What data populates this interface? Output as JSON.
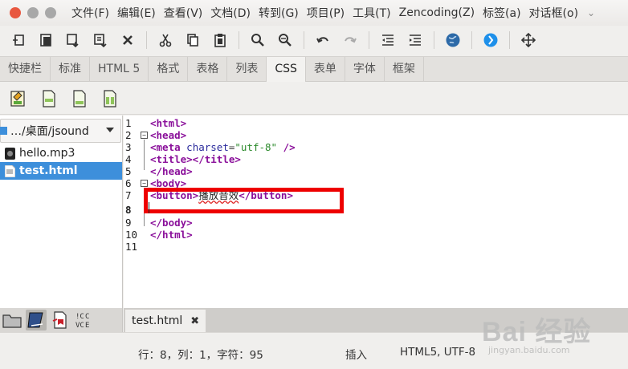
{
  "menubar": {
    "window_buttons": [
      {
        "name": "close",
        "color": "#e8573f"
      },
      {
        "name": "minimize",
        "color": "#a8a8a8"
      },
      {
        "name": "maximize",
        "color": "#a8a8a8"
      }
    ],
    "items": [
      "文件(F)",
      "编辑(E)",
      "查看(V)",
      "文档(D)",
      "转到(G)",
      "项目(P)",
      "工具(T)",
      "Zencoding(Z)",
      "标签(a)",
      "对话框(o)"
    ],
    "more_icon": "chevron-down-icon"
  },
  "toolbar": {
    "buttons": [
      "new-file-icon",
      "open-file-icon",
      "save-icon",
      "save-as-icon",
      "close-icon",
      "cut-icon",
      "copy-icon",
      "paste-icon",
      "search-icon",
      "search-replace-icon",
      "undo-icon",
      "redo-icon",
      "indent-less-icon",
      "indent-more-icon",
      "preview-globe-icon",
      "bluefish-icon",
      "fullscreen-icon"
    ]
  },
  "tabs": {
    "items": [
      "快捷栏",
      "标准",
      "HTML 5",
      "格式",
      "表格",
      "列表",
      "CSS",
      "表单",
      "字体",
      "框架"
    ],
    "active_index": 6
  },
  "subbar": {
    "icons": [
      "css-dialog-icon",
      "style-doc-icon",
      "blank-doc-icon",
      "two-col-doc-icon"
    ]
  },
  "filebrowser": {
    "path": "…/桌面/jsound",
    "files": [
      {
        "name": "hello.mp3",
        "type": "audio",
        "selected": false
      },
      {
        "name": "test.html",
        "type": "html",
        "selected": true
      }
    ]
  },
  "leftbottom": {
    "icons": [
      "folder-icon",
      "book-icon",
      "bookmark-icon",
      "charmap-icon"
    ],
    "active_index": 1
  },
  "editor": {
    "lines": [
      {
        "n": "1",
        "text": "<html>"
      },
      {
        "n": "2",
        "text": "<head>"
      },
      {
        "n": "3",
        "text": "<meta charset=\"utf-8\" />"
      },
      {
        "n": "4",
        "text": "<title></title>"
      },
      {
        "n": "5",
        "text": "</head>"
      },
      {
        "n": "6",
        "text": "<body>"
      },
      {
        "n": "7",
        "text": "<button>播放音效</button>"
      },
      {
        "n": "8",
        "text": ""
      },
      {
        "n": "9",
        "text": "</body>"
      },
      {
        "n": "10",
        "text": "</html>"
      },
      {
        "n": "11",
        "text": ""
      }
    ],
    "current_line": "8",
    "fold_lines": [
      "2",
      "6"
    ]
  },
  "doctabs": {
    "tabs": [
      {
        "label": "test.html",
        "close": "✖"
      }
    ]
  },
  "status": {
    "position": "行：8，列：1，字符：95",
    "mode": "插入",
    "encoding": "HTML5, UTF-8"
  },
  "watermark": {
    "text": "Bai 经验",
    "sub": "jingyan.baidu.com"
  },
  "colors": {
    "tag": "#8a0f9a",
    "attr": "#2a2a9c",
    "value": "#2c8a2c",
    "selection": "#3d8fdb",
    "highlight": "#ee0000"
  }
}
